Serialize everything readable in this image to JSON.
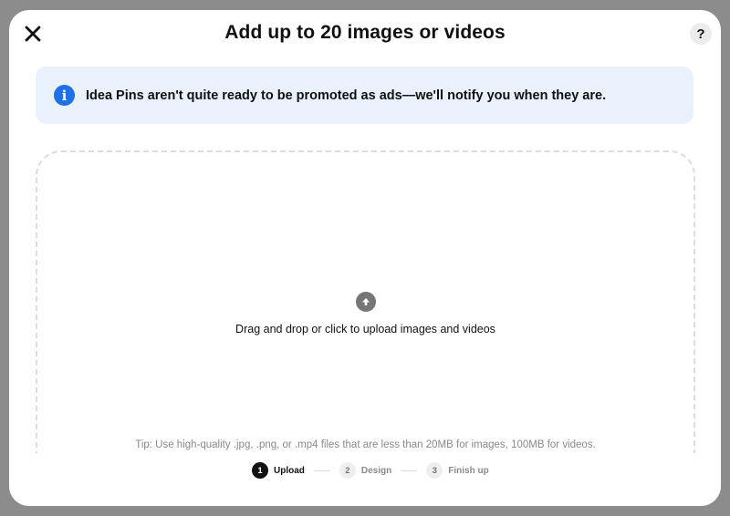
{
  "modal": {
    "title": "Add up to 20 images or videos",
    "close_icon": "close-icon",
    "help_label": "?"
  },
  "notice": {
    "icon": "info-icon",
    "icon_glyph": "i",
    "text": "Idea Pins aren't quite ready to be promoted as ads—we'll notify you when they are."
  },
  "dropzone": {
    "icon": "upload-arrow-icon",
    "label": "Drag and drop or click to upload images and videos",
    "tip": "Tip: Use high-quality .jpg, .png, or .mp4 files that are less than 20MB for images, 100MB for videos."
  },
  "stepper": {
    "steps": [
      {
        "number": "1",
        "label": "Upload",
        "active": true
      },
      {
        "number": "2",
        "label": "Design",
        "active": false
      },
      {
        "number": "3",
        "label": "Finish up",
        "active": false
      }
    ]
  },
  "colors": {
    "backdrop": "#8c8c8c",
    "notice_bg": "#e8f1fc",
    "info_blue": "#1f6fe5",
    "active_step": "#111111"
  }
}
